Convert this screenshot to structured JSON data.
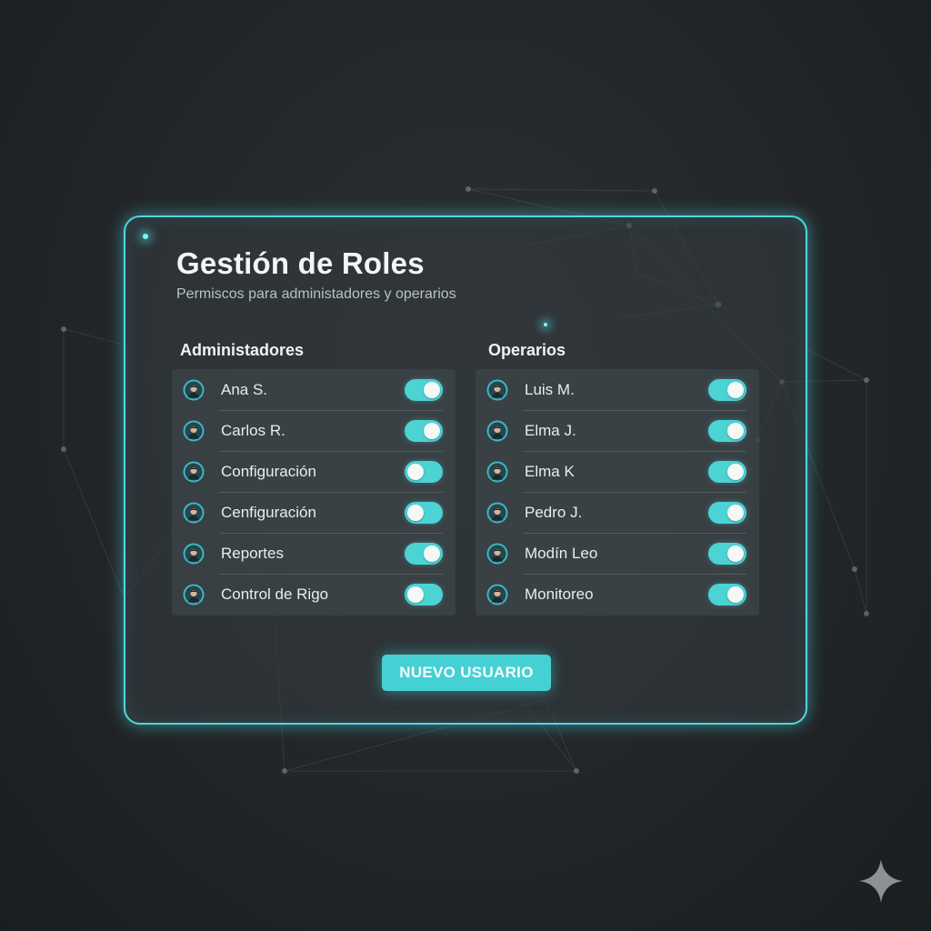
{
  "panel": {
    "title": "Gestión de Roles",
    "subtitle": "Permiscos para administadores y operarios"
  },
  "admins": {
    "heading": "Administadores",
    "items": [
      {
        "label": "Ana S.",
        "enabled": true
      },
      {
        "label": "Carlos R.",
        "enabled": true
      },
      {
        "label": "Configuración",
        "enabled": false
      },
      {
        "label": "Cenfiguración",
        "enabled": false
      },
      {
        "label": "Reportes",
        "enabled": true
      },
      {
        "label": "Control de Rigo",
        "enabled": false
      }
    ]
  },
  "operators": {
    "heading": "Operarios",
    "items": [
      {
        "label": "Luis M.",
        "enabled": true
      },
      {
        "label": "Elma J.",
        "enabled": true
      },
      {
        "label": "Elma K",
        "enabled": true
      },
      {
        "label": "Pedro J.",
        "enabled": true
      },
      {
        "label": "Modín Leo",
        "enabled": true
      },
      {
        "label": "Monitoreo",
        "enabled": true
      }
    ]
  },
  "actions": {
    "new_user_label": "NUEVO USUARIO"
  },
  "icons": {
    "avatar": "user-avatar-icon",
    "sparkle": "sparkle-icon"
  },
  "colors": {
    "accent": "#4fd8e0",
    "toggle_track": "#4cd3d3",
    "button": "#45d0d4",
    "background": "#24282b"
  }
}
